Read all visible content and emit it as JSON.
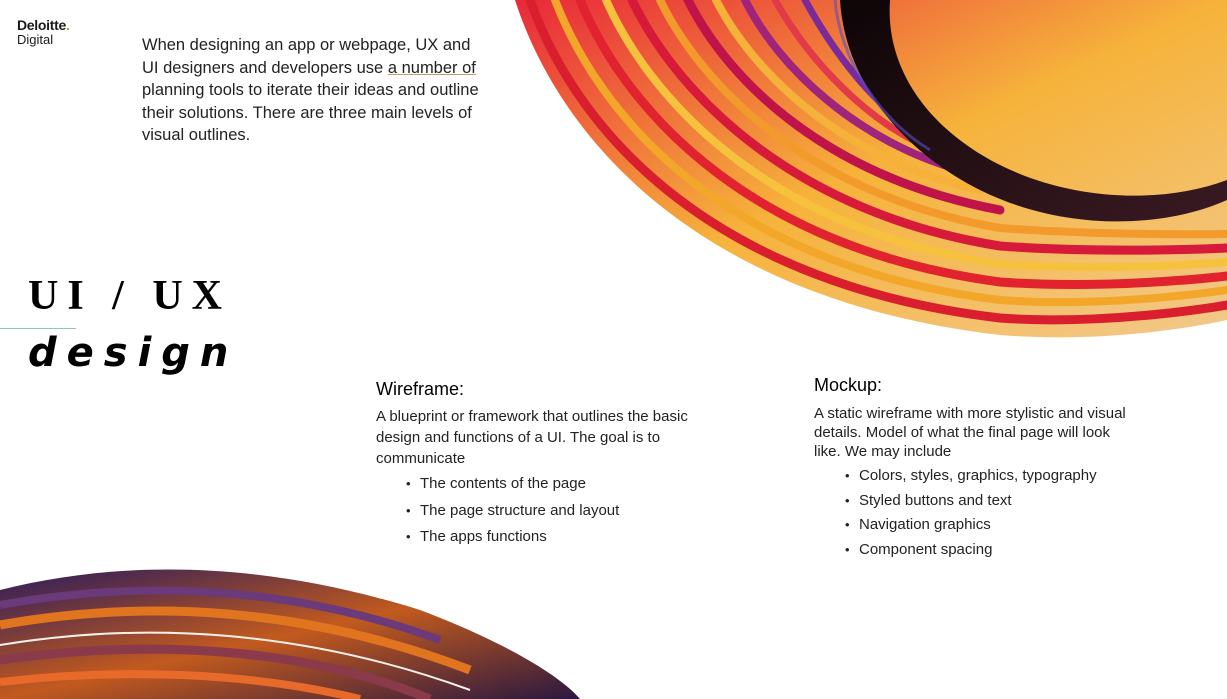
{
  "logo": {
    "brand": "Deloitte",
    "dot": ".",
    "sub": "Digital"
  },
  "intro": {
    "before": "When designing an app or webpage, UX and UI designers and developers use ",
    "underlined": "a number of",
    "after": " planning tools to iterate their ideas and outline their solutions. There are three main levels of visual outlines."
  },
  "title": {
    "line1": "UI / UX",
    "line2": "design"
  },
  "wireframe": {
    "heading": "Wireframe:",
    "body": "A blueprint or framework that outlines the basic design and functions of a UI. The goal is to communicate",
    "items": [
      "The contents of the page",
      "The page structure and layout",
      "The apps functions"
    ]
  },
  "mockup": {
    "heading": "Mockup:",
    "body": "A static wireframe with more stylistic and visual details. Model of what the final page will look like. We may include",
    "items": [
      "Colors, styles, graphics, typography",
      "Styled buttons and text",
      "Navigation graphics",
      "Component spacing"
    ]
  },
  "colors": {
    "accent_green": "#86bc25",
    "rule_teal": "#8bc6c2"
  }
}
